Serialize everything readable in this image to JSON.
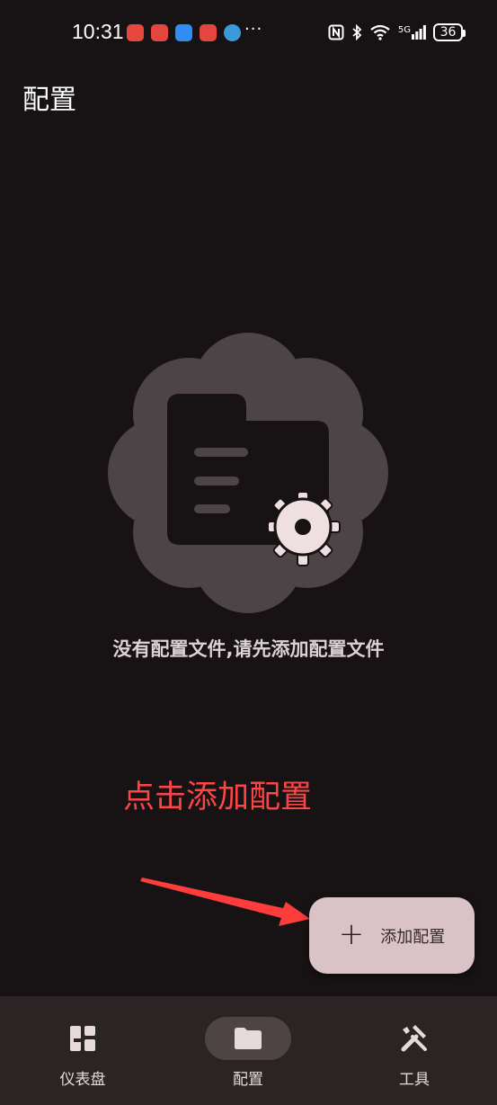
{
  "status_bar": {
    "time": "10:31",
    "more": "···",
    "network": "5G",
    "battery": "36"
  },
  "header": {
    "title": "配置"
  },
  "empty_state": {
    "message": "没有配置文件,请先添加配置文件"
  },
  "annotation": {
    "text": "点击添加配置"
  },
  "fab": {
    "icon": "plus-icon",
    "label": "添加配置"
  },
  "bottom_nav": {
    "items": [
      {
        "label": "仪表盘",
        "icon": "dashboard-icon",
        "active": false
      },
      {
        "label": "配置",
        "icon": "folder-icon",
        "active": true
      },
      {
        "label": "工具",
        "icon": "tools-icon",
        "active": false
      }
    ]
  },
  "colors": {
    "background": "#171314",
    "fab": "#d9c3c6",
    "nav_bar": "#2b2425",
    "annotation": "#ff4545"
  }
}
